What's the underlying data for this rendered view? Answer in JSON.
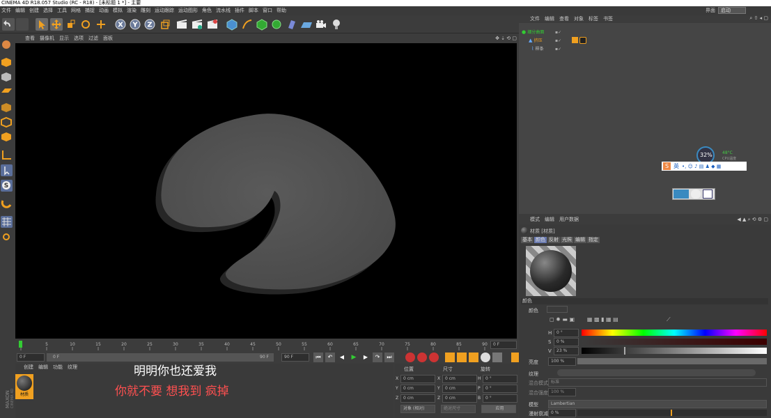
{
  "window": {
    "title": "CINEMA 4D R18.057 Studio (RC - R18) - [未标题 1 *] - 主要"
  },
  "menu": [
    "文件",
    "编辑",
    "创建",
    "选择",
    "工具",
    "网格",
    "捕捉",
    "动画",
    "模拟",
    "渲染",
    "雕刻",
    "运动跟踪",
    "运动图形",
    "角色",
    "流水线",
    "插件",
    "脚本",
    "窗口",
    "帮助"
  ],
  "layout": {
    "label": "界面",
    "value": "启动"
  },
  "viewport": {
    "menu": [
      "查看",
      "摄像机",
      "显示",
      "选项",
      "过滤",
      "面板"
    ]
  },
  "timeline": {
    "ticks": [
      "0",
      "5",
      "10",
      "15",
      "20",
      "25",
      "30",
      "35",
      "40",
      "45",
      "50",
      "55",
      "60",
      "65",
      "70",
      "75",
      "80",
      "85",
      "90"
    ],
    "current_frame": "0 F"
  },
  "transport": {
    "start": "0 F",
    "slider_left": "0 F",
    "slider_right": "90 F",
    "end": "90 F"
  },
  "material_manager": {
    "menu": [
      "创建",
      "编辑",
      "功能",
      "纹理"
    ],
    "material_name": "材质"
  },
  "subtitles": {
    "line1": "明明你也还爱我",
    "line2": "你就不要 想我到 疯掉"
  },
  "coordinates": {
    "headers": [
      "位置",
      "尺寸",
      "旋转"
    ],
    "rows": [
      {
        "a": "X",
        "av": "0 cm",
        "b": "X",
        "bv": "0 cm",
        "c": "H",
        "cv": "0 °"
      },
      {
        "a": "Y",
        "av": "0 cm",
        "b": "Y",
        "bv": "0 cm",
        "c": "P",
        "cv": "0 °"
      },
      {
        "a": "Z",
        "av": "0 cm",
        "b": "Z",
        "bv": "0 cm",
        "c": "B",
        "cv": "0 °"
      }
    ],
    "mode": "对象 (相对)",
    "size_mode": "绝对尺寸",
    "apply": "应用"
  },
  "object_manager": {
    "menu": [
      "文件",
      "编辑",
      "查看",
      "对象",
      "标签",
      "书签"
    ],
    "objects": [
      {
        "name": "细分曲面"
      },
      {
        "name": "挤压"
      },
      {
        "name": "样条"
      }
    ]
  },
  "overlay": {
    "cpu_percent": "32%",
    "temp": "48°C",
    "cpu_label": "CPU温度",
    "ime": "英"
  },
  "attributes": {
    "menu": [
      "模式",
      "编辑",
      "用户数据"
    ],
    "title": "材质 [材质]",
    "tabs": [
      "基本",
      "颜色",
      "反射",
      "光照",
      "编辑",
      "指定"
    ],
    "section": "颜色",
    "color_label": "颜色",
    "h": {
      "label": "H",
      "value": "0 °"
    },
    "s": {
      "label": "S",
      "value": "0 %"
    },
    "v": {
      "label": "V",
      "value": "23 %"
    },
    "brightness": {
      "label": "亮度",
      "value": "100 %",
      "fraction": 1.0
    },
    "texture": {
      "label": "纹理"
    },
    "blend_mode": {
      "label": "混合模式",
      "value": "标准"
    },
    "blend_strength": {
      "label": "混合强度",
      "value": "100 %"
    },
    "model": {
      "label": "模型",
      "value": "Lambertian"
    },
    "diffuse_falloff": {
      "label": "漫射衰减",
      "value": "0 %"
    }
  },
  "colors": {
    "accent": "#f0a020",
    "bg": "#3c3c3c",
    "panel": "#454545"
  }
}
